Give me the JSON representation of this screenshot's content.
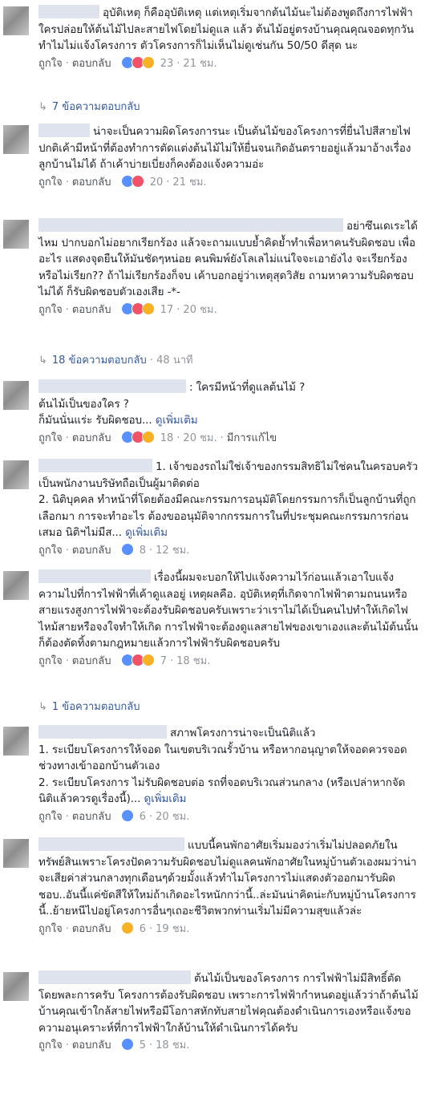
{
  "actions": {
    "like": "ถูกใจ",
    "reply": "ตอบกลับ",
    "see_more": "ดูเพิ่มเติม",
    "edited": "มีการแก้ไข"
  },
  "comments": [
    {
      "text": "อุบัติเหตุ ก็คืออุบัติเหตุ แต่เหตุเริ่มจากต้นไม้นะไม่ต้องพูดถึงการไฟฟ้า ใครปล่อยให้ต้นไม้ไปละสายไฟโดยไม่ดูแล แล้ว ต้นไม้อยู่ตรงบ้านคุณคุณจอดทุกวันทำไมไม่แจ้งโครงการ ตัวโครงการก็ไม่เห็นไม่ดูเช่นกัน 50/50 ดีสุด นะ",
      "reactions": "23",
      "reaction_types": [
        "like",
        "love",
        "haha"
      ],
      "time": "21 ชม."
    },
    {
      "text": "น่าจะเป็นความผิดโครงการนะ เป็นต้นไม้ของโครงการที่ยื่นไปสีสายไฟ ปกติเค้ามีหน้าที่ต้องทำการตัดแต่งต้นไม้ไม่ให้ยื่นจนเกิดอันตรายอยู่แล้วมาอ้างเรื่องลูกบ้านไม่ได้ ถ้าเค้าบ่ายเบี่ยงก็คงต้องแจ้งความอ่ะ",
      "reactions": "20",
      "reaction_types": [
        "like",
        "love"
      ],
      "time": "21 ชม."
    },
    {
      "text": "อย่าซึนเดเระได้ไหม ปากบอกไม่อยากเรียกร้อง แล้วจะถามแบบย้ำคิดย้ำทำเพื่อหาคนรับผิดชอบ เพื่ออะไร แสดงจุดยืนให้มันชัดๆหน่อย คนพิมพ์ยังโลเลไม่แน่ใจจะเอายังไง จะเรียกร้องหรือไม่เรียก?? ถ้าไม่เรียกร้องก็จบ เค้าบอกอยู่ว่าเหตุสุดวิสัย ถามหาความรับผิดชอบไม่ได้ ก็รับผิดชอบตัวเองเสีย -*-",
      "reactions": "17",
      "reaction_types": [
        "like",
        "love",
        "haha"
      ],
      "time": "20 ชม."
    },
    {
      "text": ": ใครมีหน้าที่ดูแลต้นไม้ ?\nต้นไม้เป็นของใคร ?\nก็มันนั่นแร่ะ รับผิดชอบ...",
      "see_more": true,
      "reactions": "18",
      "reaction_types": [
        "like",
        "love",
        "haha"
      ],
      "time": "20 ชม.",
      "edited": true
    },
    {
      "text": "1. เจ้าของรถไม่ใช่เจ้าของกรรมสิทธิไม่ใช่คนในครอบครัว เป็นพนักงานบริษัทถือเป็นผู้มาติดต่อ\n2. นิติบุคคล ทำหน้าที่โดยต้องมีคณะกรรมการอนุมัติโดยกรรมการก็เป็นลูกบ้านที่ถูกเลือกมา การจะทำอะไร ต้องขออนุมัติจากกรรมการในที่ประชุมคณะกรรมการก่อน เสมอ นิติฯไม่มีส...",
      "see_more": true,
      "reactions": "8",
      "reaction_types": [
        "like"
      ],
      "time": "12 ชม."
    },
    {
      "text": "เรื่องนี้ผมจะบอกให้ไปแจ้งความไว้ก่อนแล้วเอาใบแจ้งความไปที่การไฟฟ้าที่เค้าดูแลอยู่ เหตุผลคือ. อุบัติเหตุที่เกิดจากไฟฟ้าตามถนนหรือสายแรงสูงการไฟฟ้าจะต้องรับผิดชอบครับเพราะว่าเราไม่ได้เป็นคนไปทำให้เกิดไฟไหม้สายหรือจงใจทำให้เกิด การไฟฟ้าจะต้องดูแลสายไฟของเขาเองและต้นไม้ต้นนั้นก็ต้องตัดทิ้งตามกฎหมายแล้วการไฟฟ้ารับผิดชอบครับ",
      "reactions": "7",
      "reaction_types": [
        "like",
        "love",
        "haha"
      ],
      "time": "18 ชม."
    },
    {
      "text": "สภาพโครงการน่าจะเป็นนิติแล้ว\n1. ระเบียบโครงการให้จอด ในเขตบริเวณรั้วบ้าน หรือหากอนุญาตให้จอดควรจอดช่วงทางเข้าออกบ้านตัวเอง\n2. ระเบียบโครงการ ไม่รับผิดชอบต่อ รถที่จอดบริเวณส่วนกลาง (หรือเปล่าหากจัดนิติแล้วควรดูเรื่องนี้)...",
      "see_more": true,
      "reactions": "6",
      "reaction_types": [
        "like"
      ],
      "time": "20 ชม."
    },
    {
      "text": "แบบนี้คนพักอาศัยเริ่มมองว่าเริ่มไม่ปลอดภัยในทรัพย์สินเพราะโครงปัดความรับผิดชอบไม่ดูแลคนพักอาศัยในหมู่บ้านตัวเองผมว่าน่าจะเสียค่าส่วนกลางทุกเดือนๆด้วยมั้งแล้วทำไมโครงการไม่แสดงตัวออกมารับผิดชอบ..อันนี้แค่ขัดสีให้ใหม่ถ้าเกิดอะไรหนักกว่านี้..ล่ะมันน่าคิดน่ะกับหมู่บ้านโครงการนี้..ย้ายหนีไปอยู่โครงการอื่นๆเถอะชีวิตพวกท่านเริ่มไม่มีความสุขแล้วล่ะ",
      "reactions": "6",
      "reaction_types": [
        "haha"
      ],
      "time": "19 ชม."
    },
    {
      "text": "ต้นไม้เป็นของโครงการ การไฟฟ้าไม่มีสิทธิ์ตัดโดยพละการครับ โครงการต้องรับผิดชอบ เพราะการไฟฟ้ากำหนดอยู่แล้วว่าถ้าต้นไม้บ้านคุณเข้าใกล้สายไฟหรือมีโอกาสหักทับสายไฟคุณต้องดำเนินการเองหรือแจ้งขอความอนุเคราะห์ที่การไฟฟ้าใกล้บ้านให้ดำเนินการได้ครับ",
      "reactions": "5",
      "reaction_types": [
        "like"
      ],
      "time": "18 ชม."
    }
  ],
  "reply_links": [
    {
      "text": "7 ข้อความตอบกลับ",
      "time": ""
    },
    {
      "text": "18 ข้อความตอบกลับ",
      "time": "48 นาที"
    },
    {
      "text": "1 ข้อความตอบกลับ",
      "time": ""
    }
  ]
}
